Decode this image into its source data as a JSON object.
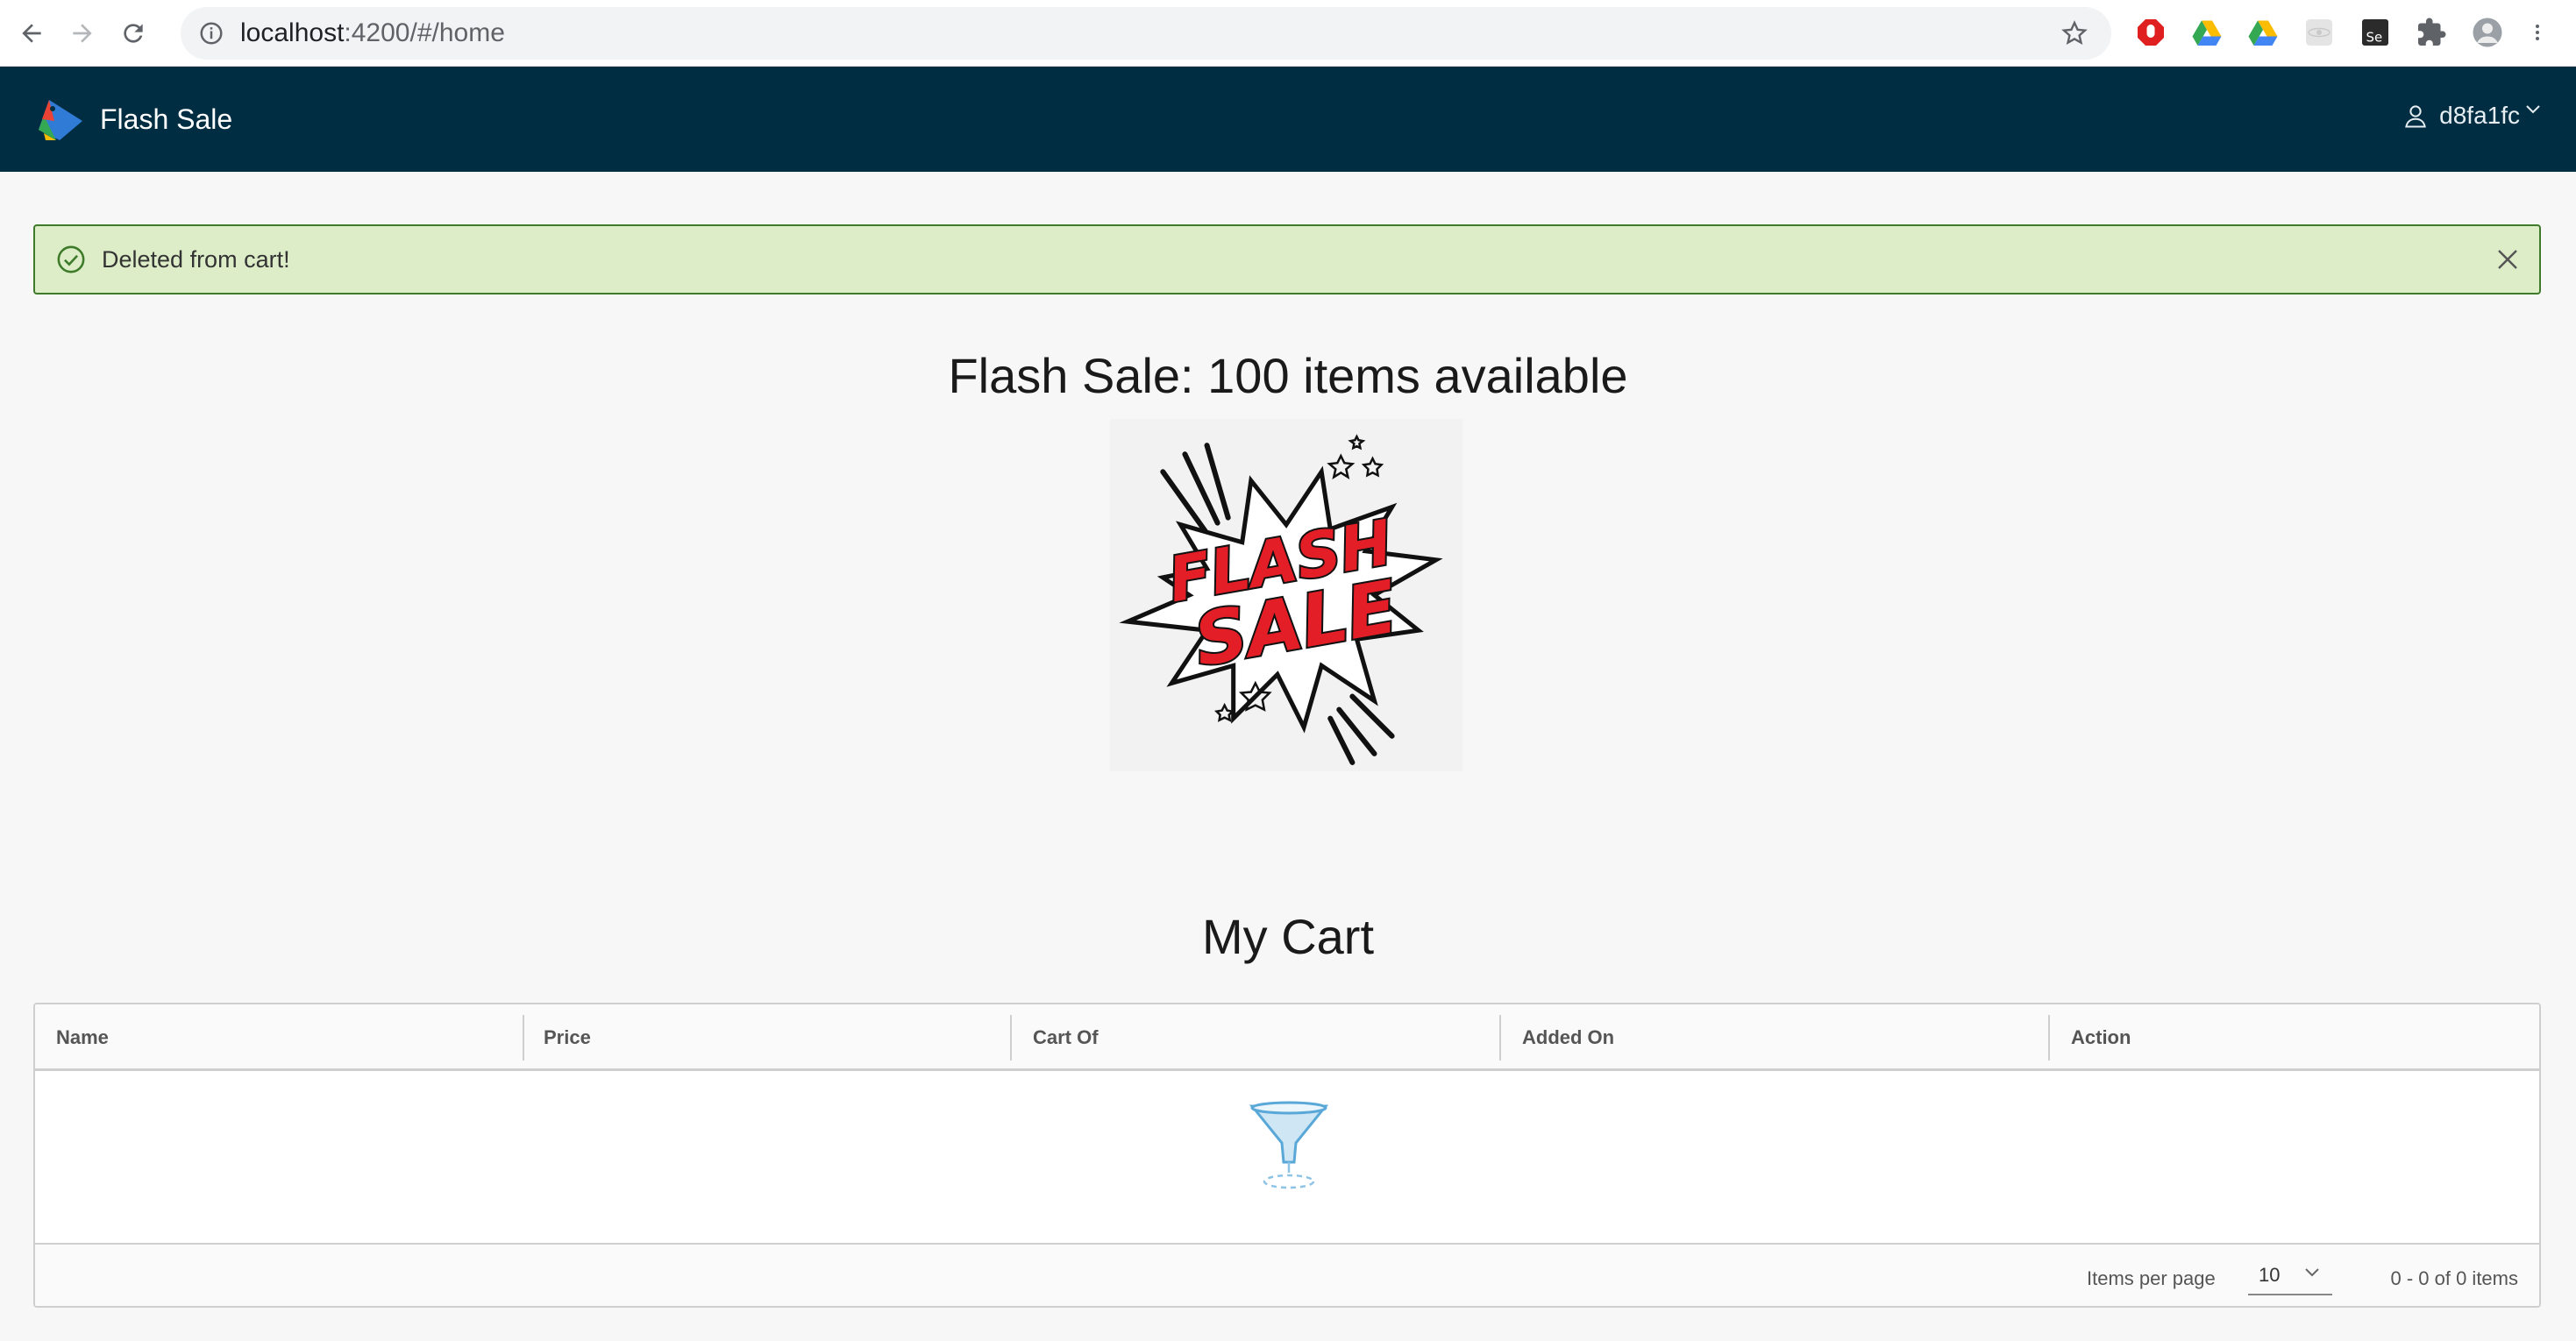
{
  "browser": {
    "url_host": "localhost",
    "url_path": ":4200/#/home"
  },
  "header": {
    "brand_title": "Flash Sale",
    "user_name": "d8fa1fc"
  },
  "alert": {
    "message": "Deleted from cart!",
    "status_color": "#dcedc8"
  },
  "main": {
    "sale_heading": "Flash Sale: 100 items available",
    "sale_image_text_1": "FLASH",
    "sale_image_text_2": "SALE",
    "cart_heading": "My Cart"
  },
  "cart_grid": {
    "columns": [
      "Name",
      "Price",
      "Cart Of",
      "Added On",
      "Action"
    ],
    "rows": [],
    "footer": {
      "items_per_page_label": "Items per page",
      "items_per_page_value": "10",
      "pagination_text": "0 - 0 of 0 items"
    }
  },
  "colors": {
    "header_bg": "#002d42",
    "alert_border": "#3d7a29",
    "accent_red": "#e41e26"
  }
}
